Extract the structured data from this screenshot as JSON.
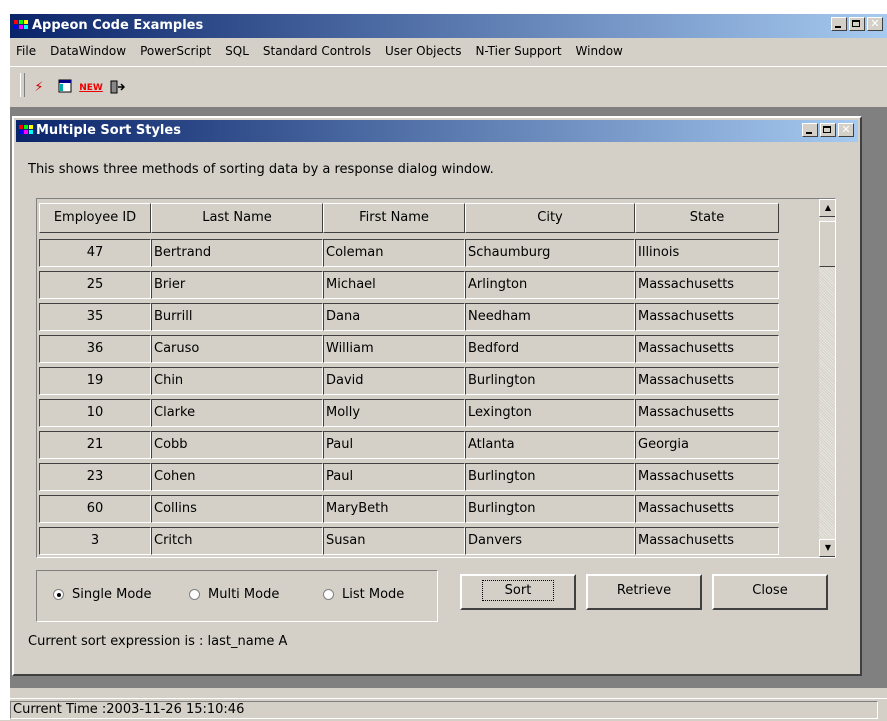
{
  "app": {
    "title": "Appeon Code Examples"
  },
  "menu": [
    "File",
    "DataWindow",
    "PowerScript",
    "SQL",
    "Standard Controls",
    "User Objects",
    "N-Tier Support",
    "Window"
  ],
  "toolbar": {
    "new_label": "NEW"
  },
  "child": {
    "title": "Multiple Sort Styles",
    "description": "This shows three methods of sorting data by a response dialog window."
  },
  "grid": {
    "columns": [
      "Employee ID",
      "Last Name",
      "First Name",
      "City",
      "State"
    ],
    "rows": [
      [
        "47",
        "Bertrand",
        "Coleman",
        "Schaumburg",
        "Illinois"
      ],
      [
        "25",
        "Brier",
        "Michael",
        "Arlington",
        "Massachusetts"
      ],
      [
        "35",
        "Burrill",
        "Dana",
        "Needham",
        "Massachusetts"
      ],
      [
        "36",
        "Caruso",
        "William",
        "Bedford",
        "Massachusetts"
      ],
      [
        "19",
        "Chin",
        "David",
        "Burlington",
        "Massachusetts"
      ],
      [
        "10",
        "Clarke",
        "Molly",
        "Lexington",
        "Massachusetts"
      ],
      [
        "21",
        "Cobb",
        "Paul",
        "Atlanta",
        "Georgia"
      ],
      [
        "23",
        "Cohen",
        "Paul",
        "Burlington",
        "Massachusetts"
      ],
      [
        "60",
        "Collins",
        "MaryBeth",
        "Burlington",
        "Massachusetts"
      ],
      [
        "3",
        "Critch",
        "Susan",
        "Danvers",
        "Massachusetts"
      ]
    ]
  },
  "modes": {
    "single": "Single Mode",
    "multi": "Multi Mode",
    "list": "List Mode",
    "selected": "single"
  },
  "buttons": {
    "sort": "Sort",
    "retrieve": "Retrieve",
    "close": "Close"
  },
  "sort_expression": "Current sort expression is : last_name A",
  "status": {
    "text": "Current Time :2003-11-26 15:10:46"
  },
  "colors": {
    "title_start": "#0a246a",
    "title_end": "#a6caf0",
    "face": "#d4d0c8"
  }
}
